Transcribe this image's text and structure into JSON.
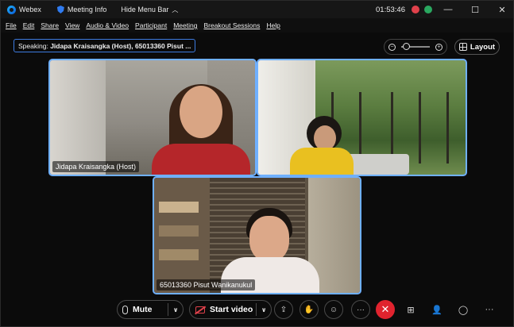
{
  "titlebar": {
    "app_name": "Webex",
    "meeting_info": "Meeting Info",
    "hide_menu_bar": "Hide Menu Bar",
    "time": "01:53:46",
    "minimize": "—",
    "maximize": "☐",
    "close": "✕"
  },
  "menu": [
    "File",
    "Edit",
    "Share",
    "View",
    "Audio & Video",
    "Participant",
    "Meeting",
    "Breakout Sessions",
    "Help"
  ],
  "speaking": {
    "prefix": "Speaking:",
    "names": "Jidapa Kraisangka (Host), 65013360 Pisut ..."
  },
  "layout_button": "Layout",
  "tiles": [
    {
      "name": "Jidapa Kraisangka (Host)",
      "active": true
    },
    {
      "name": "",
      "active": true
    },
    {
      "name": "65013360 Pisut Wanikanukul",
      "active": true
    }
  ],
  "controls": {
    "mute_label": "Mute",
    "start_video_label": "Start video",
    "more": "···",
    "end": "✕"
  },
  "colors": {
    "accent": "#6fb0ff",
    "end_call": "#e0232e",
    "video_off": "#e0414b"
  }
}
